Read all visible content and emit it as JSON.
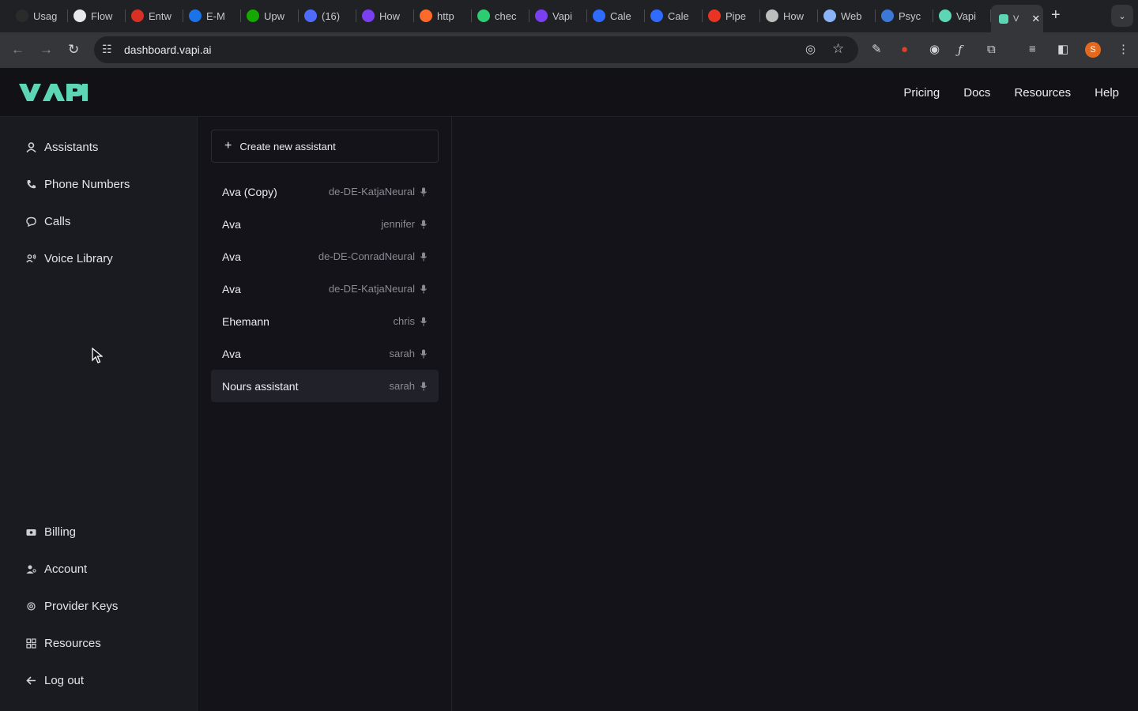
{
  "browser": {
    "tabs": [
      {
        "label": "Usag",
        "color": "#2b2b2b"
      },
      {
        "label": "Flow",
        "color": "#e8e8ea"
      },
      {
        "label": "Entw",
        "color": "#d93025"
      },
      {
        "label": "E-M",
        "color": "#1a73e8"
      },
      {
        "label": "Upw",
        "color": "#14a800"
      },
      {
        "label": "(16)",
        "color": "#4f6bff"
      },
      {
        "label": "How",
        "color": "#7b3ff2"
      },
      {
        "label": "http",
        "color": "#ff6a2b"
      },
      {
        "label": "chec",
        "color": "#2ecc71"
      },
      {
        "label": "Vapi",
        "color": "#7b3ff2"
      },
      {
        "label": "Cale",
        "color": "#2f6bff"
      },
      {
        "label": "Cale",
        "color": "#2f6bff"
      },
      {
        "label": "Pipe",
        "color": "#ea3323"
      },
      {
        "label": "How",
        "color": "#bdbdbd"
      },
      {
        "label": "Web",
        "color": "#8ab4f8"
      },
      {
        "label": "Psyc",
        "color": "#3c78d8"
      },
      {
        "label": "Vapi",
        "color": "#5dd6b6"
      }
    ],
    "active_tab": {
      "label": "V",
      "close": "✕"
    },
    "new_tab": "+",
    "url": "dashboard.vapi.ai",
    "profile_initial": "S"
  },
  "header": {
    "logo_text": "VAPI",
    "nav": [
      "Pricing",
      "Docs",
      "Resources",
      "Help"
    ]
  },
  "sidebar": {
    "top_items": [
      {
        "label": "Assistants",
        "icon": "person-icon"
      },
      {
        "label": "Phone Numbers",
        "icon": "phone-icon"
      },
      {
        "label": "Calls",
        "icon": "chat-icon"
      },
      {
        "label": "Voice Library",
        "icon": "users-icon"
      }
    ],
    "bottom_items": [
      {
        "label": "Billing",
        "icon": "billing-icon"
      },
      {
        "label": "Account",
        "icon": "account-icon"
      },
      {
        "label": "Provider Keys",
        "icon": "key-icon"
      },
      {
        "label": "Resources",
        "icon": "grid-icon"
      },
      {
        "label": "Log out",
        "icon": "arrow-left-icon"
      }
    ]
  },
  "assistants": {
    "create_label": "Create new assistant",
    "items": [
      {
        "name": "Ava (Copy)",
        "voice": "de-DE-KatjaNeural"
      },
      {
        "name": "Ava",
        "voice": "jennifer"
      },
      {
        "name": "Ava",
        "voice": "de-DE-ConradNeural"
      },
      {
        "name": "Ava",
        "voice": "de-DE-KatjaNeural"
      },
      {
        "name": "Ehemann",
        "voice": "chris"
      },
      {
        "name": "Ava",
        "voice": "sarah"
      },
      {
        "name": "Nours assistant",
        "voice": "sarah",
        "selected": true
      }
    ]
  },
  "colors": {
    "brand": "#5dd6b6",
    "background": "#14131a",
    "sidebar": "#1a1a21"
  }
}
